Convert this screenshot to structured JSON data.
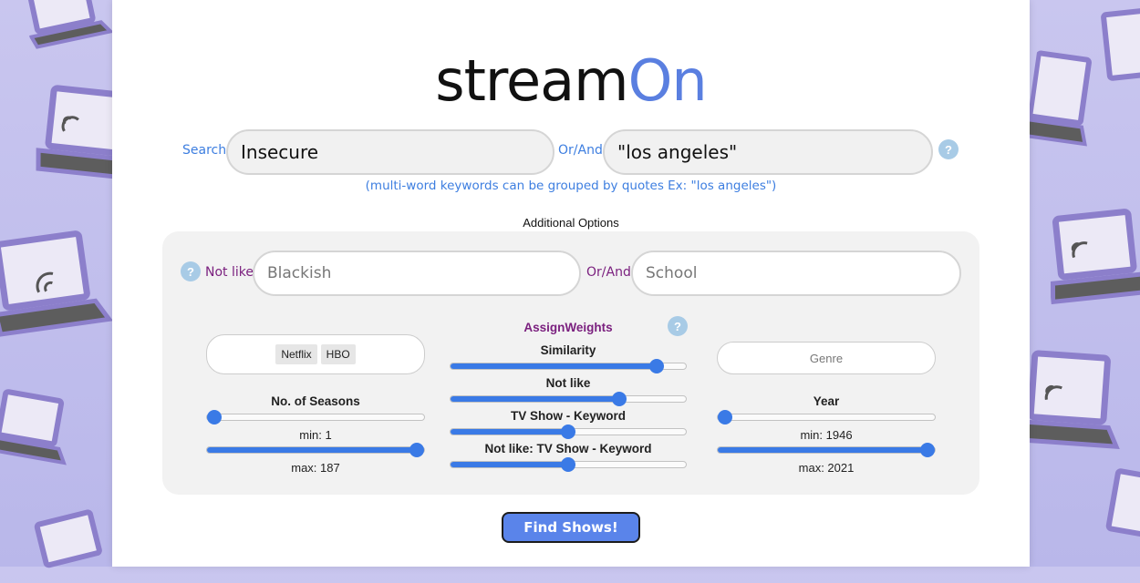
{
  "logo": {
    "text_main": "stream",
    "text_accent": "On"
  },
  "search": {
    "label": "Search",
    "value": "Insecure",
    "or_and_label": "Or/And",
    "keyword_value": "\"los angeles\"",
    "hint": "(multi-word keywords can be grouped by quotes Ex: \"los angeles\")"
  },
  "help_glyph": "?",
  "additional": {
    "title": "Additional Options",
    "not_like_label": "Not like",
    "not_like_placeholder": "Blackish",
    "or_and_label": "Or/And",
    "or_and_placeholder": "School"
  },
  "platforms": {
    "tags": [
      "Netflix",
      "HBO"
    ]
  },
  "genre": {
    "placeholder": "Genre"
  },
  "seasons": {
    "title": "No. of Seasons",
    "min_text": "min: 1",
    "max_text": "max: 187",
    "min": 1,
    "max": 187,
    "range_min": 1,
    "range_max": 187
  },
  "weights": {
    "title": "AssignWeights",
    "sliders": [
      {
        "label": "Similarity",
        "value": 0.9
      },
      {
        "label": "Not like",
        "value": 0.73
      },
      {
        "label": "TV Show - Keyword",
        "value": 0.5
      },
      {
        "label": "Not like: TV Show - Keyword",
        "value": 0.5
      }
    ]
  },
  "year": {
    "title": "Year",
    "min_text": "min: 1946",
    "max_text": "max: 2021",
    "min": 1946,
    "max": 2021,
    "range_min": 1946,
    "range_max": 2021
  },
  "find_button": "Find Shows!",
  "colors": {
    "accent_blue": "#5a7fe0",
    "label_purple": "#7a1f7e",
    "slider_blue": "#3a7ae6",
    "help_blue": "#a8cbe6"
  },
  "background_icons": "laptop-wifi-icon"
}
